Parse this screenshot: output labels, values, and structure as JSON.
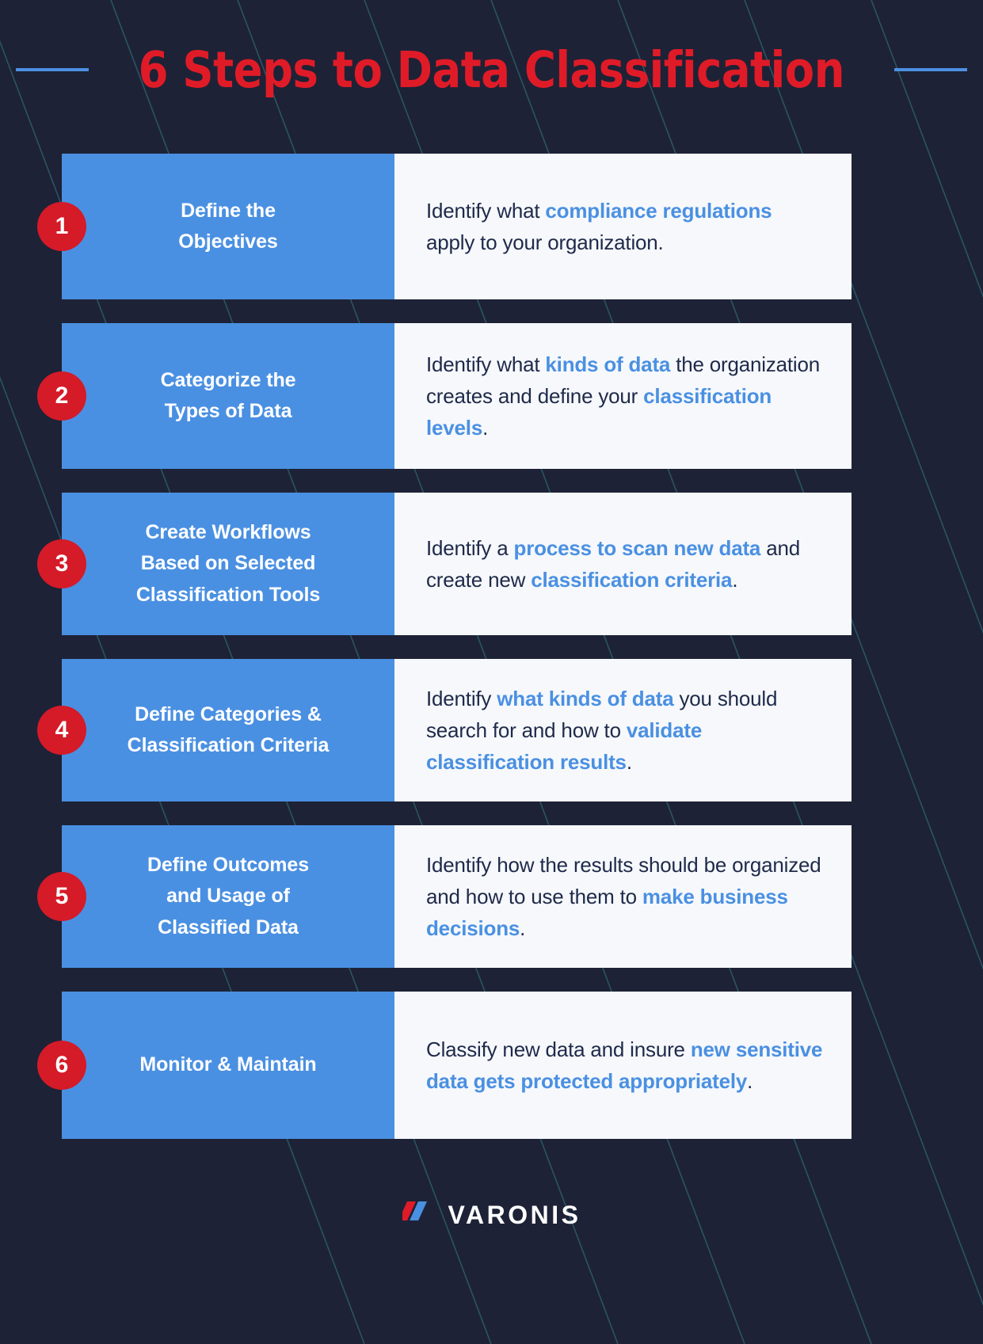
{
  "header": {
    "title": "6 Steps to Data Classification",
    "rule_color": "#4b91e2"
  },
  "theme": {
    "background": "#1e2236",
    "panel_blue": "#4a90e2",
    "panel_light": "#f6f8fb",
    "badge_red": "#d51a28",
    "title_red": "#e01b28",
    "body_navy": "#1f2a4a",
    "highlight_blue": "#4a90e2",
    "diagonal_line": "#2a5f6b"
  },
  "steps": [
    {
      "number": "1",
      "title": "Define the\nObjectives",
      "body_html": "Identify what <b>compliance regulations</b> apply to your organization."
    },
    {
      "number": "2",
      "title": "Categorize the\nTypes of Data",
      "body_html": "Identify what <b>kinds of data</b> the organization creates and define your <b>classification levels</b>."
    },
    {
      "number": "3",
      "title": "Create Workflows\nBased on Selected\nClassification Tools",
      "body_html": "Identify a <b>process to scan new data</b> and create new <b>classification criteria</b>."
    },
    {
      "number": "4",
      "title": "Define Categories &\nClassification Criteria",
      "body_html": "Identify <b>what kinds of data</b> you should search for and how to <b>validate classification results</b>."
    },
    {
      "number": "5",
      "title": "Define Outcomes\nand Usage of\nClassified Data",
      "body_html": "Identify how the results should be organized and how to use them to <b>make business decisions</b>."
    },
    {
      "number": "6",
      "title": "Monitor & Maintain",
      "body_html": "Classify new data and insure <b>new sensitive data gets protected appropriately</b>."
    }
  ],
  "footer": {
    "logo_wordmark": "VARONIS",
    "logo_icon": "varonis-slash-mark",
    "logo_slash_red": "#e01b28",
    "logo_slash_blue": "#4a90e2"
  }
}
